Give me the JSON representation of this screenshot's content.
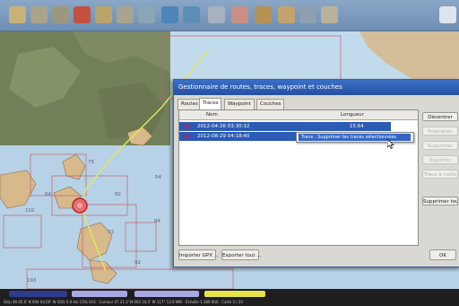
{
  "colors": {
    "sea": "#b7d2e6",
    "land": "#d7b98c",
    "satellite": "#7d8a64",
    "route_line": "#e2e85a",
    "selection_blue": "#2b5bb5",
    "status_navy": "#2f3b8c",
    "status_lavender": "#a9a8e6",
    "status_yellow": "#e6e24a"
  },
  "toolbar": {
    "icons": [
      "zoom-icon",
      "ship-icon",
      "route-icon",
      "pencil-icon",
      "measure-icon",
      "track-icon",
      "layer-icon",
      "chart-icon",
      "grid-icon",
      "tide-icon",
      "folder-icon",
      "settings-icon",
      "book-icon",
      "flag-icon",
      "tools-icon"
    ]
  },
  "dialog": {
    "title": "Gestionnaire de routes, traces, waypoint et couches",
    "tabs": [
      {
        "label": "Routes",
        "active": false
      },
      {
        "label": "Traces",
        "active": true
      },
      {
        "label": "Waypoint",
        "active": false
      },
      {
        "label": "Couches",
        "active": false
      }
    ],
    "columns": {
      "visible": "",
      "name": "Nom",
      "length": "Longueur"
    },
    "rows": [
      {
        "name": "2012-04-26 03:30:32",
        "length": "15.64"
      },
      {
        "name": "2012-08-29 04:18:40",
        "length": ""
      }
    ],
    "context_menu": "Trace : Supprimer les traces sélectionnées",
    "side_buttons": [
      {
        "label": "Décentrer",
        "enabled": true
      },
      {
        "label": "Propriétés",
        "enabled": false
      },
      {
        "label": "Supprimer",
        "enabled": false
      },
      {
        "label": "Exporter",
        "enabled": false
      },
      {
        "label": "Trace à route",
        "enabled": false
      },
      {
        "label": "Supprimer tout",
        "enabled": true
      }
    ],
    "buttons": {
      "import": "Importer GPX ...",
      "export": "Exporter tout ...",
      "ok": "OK"
    }
  },
  "map": {
    "labels": [
      "75",
      "82",
      "64",
      "84",
      "73",
      "92",
      "54",
      "102",
      "193"
    ]
  },
  "statusbar": {
    "text": "Ship 46 05.0' N 004 04.00' W  SOG 0.0 kts  COG 016  ·  Curseur 47 21.2' N 003 34.5' W  117° 13.8 NMi  ·  Échelle 1:189 000  ·  Carte 3 / 24"
  }
}
